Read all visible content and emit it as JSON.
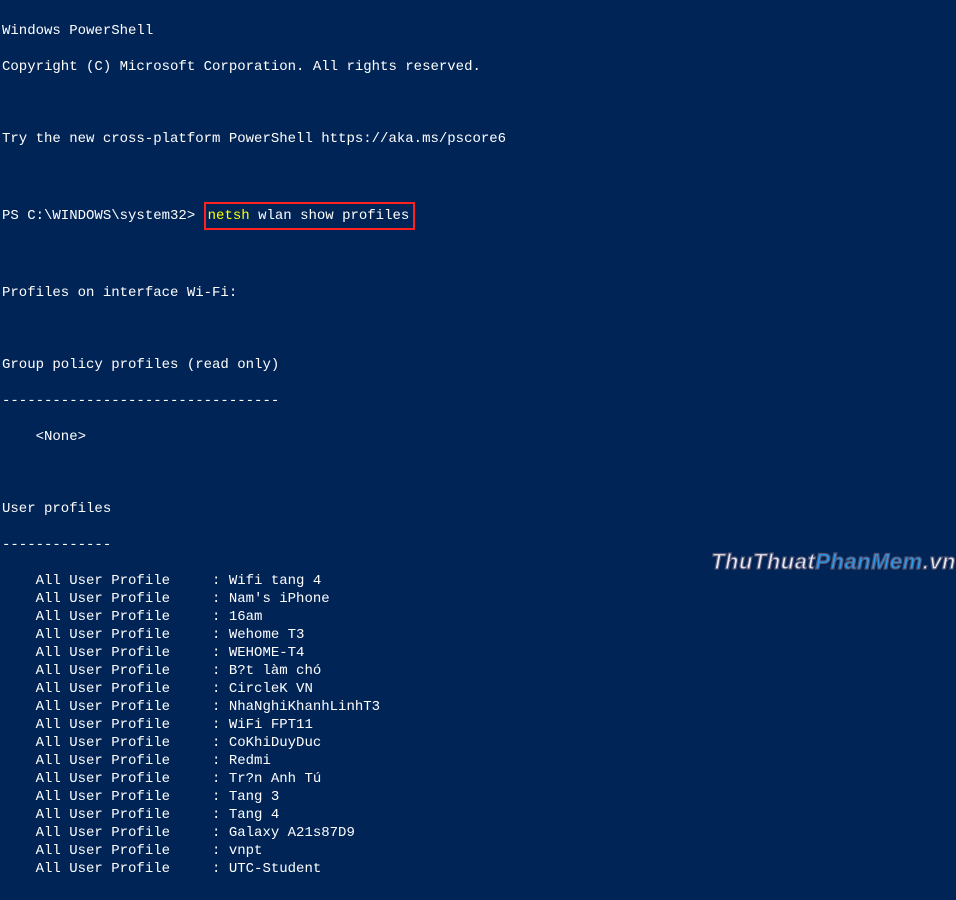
{
  "header": {
    "title": "Windows PowerShell",
    "copyright": "Copyright (C) Microsoft Corporation. All rights reserved.",
    "tip": "Try the new cross-platform PowerShell https://aka.ms/pscore6"
  },
  "prompt": {
    "prefix": "PS C:\\WINDOWS\\system32>",
    "cmd_exe": "netsh",
    "cmd_args": "wlan show profiles"
  },
  "output": {
    "profiles_header": "Profiles on interface Wi-Fi:",
    "group_policy_header": "Group policy profiles (read only)",
    "group_policy_sep": "---------------------------------",
    "group_policy_none": "    <None>",
    "user_profiles_header": "User profiles",
    "user_profiles_sep": "-------------",
    "profile_label": "All User Profile",
    "profiles": [
      "Wifi tang 4",
      "Nam's iPhone",
      "16am",
      "Wehome T3",
      "WEHOME-T4",
      "B?t làm chó",
      "CircleK VN",
      "NhaNghiKhanhLinhT3",
      "WiFi FPT11",
      "CoKhiDuyDuc",
      "Redmi",
      "Tr?n Anh Tú",
      "Tang 3",
      "Tang 4",
      "Galaxy A21s87D9",
      "vnpt",
      "UTC-Student"
    ]
  },
  "watermark": {
    "part1": "ThuThuat",
    "part2": "PhanMem",
    "part3": ".vn"
  }
}
